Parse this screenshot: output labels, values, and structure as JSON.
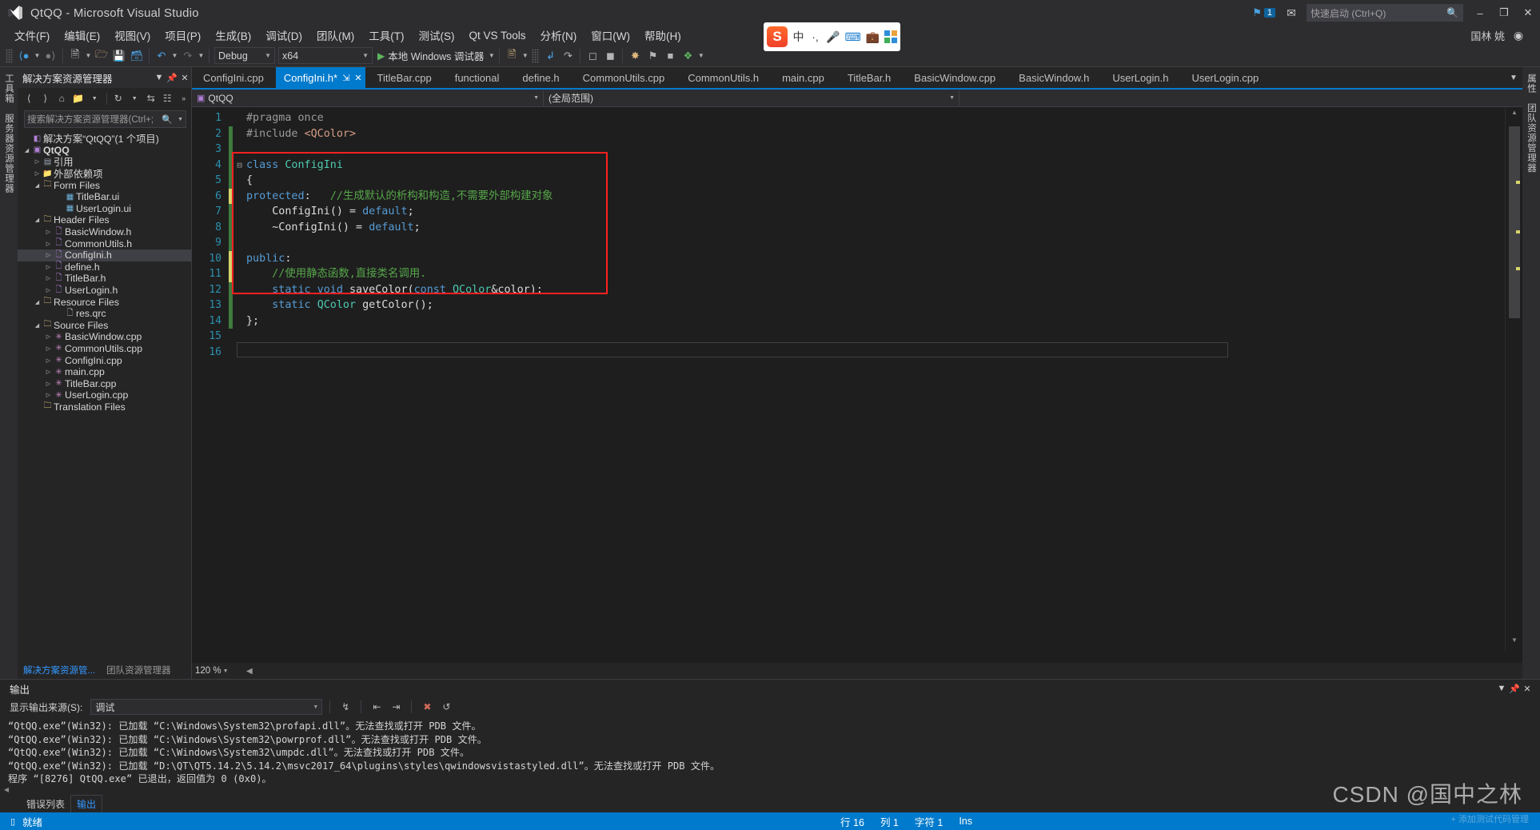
{
  "window": {
    "title": "QtQQ - Microsoft Visual Studio",
    "minimize": "–",
    "maximize": "❐",
    "close": "✕",
    "user_name": "国林 姚",
    "lang_flag": "中",
    "notify_count": "1"
  },
  "quick_launch": {
    "placeholder": "快速启动 (Ctrl+Q)"
  },
  "menu": {
    "items": [
      "文件(F)",
      "编辑(E)",
      "视图(V)",
      "项目(P)",
      "生成(B)",
      "调试(D)",
      "团队(M)",
      "工具(T)",
      "测试(S)",
      "Qt VS Tools",
      "分析(N)",
      "窗口(W)",
      "帮助(H)"
    ]
  },
  "toolbar": {
    "config": "Debug",
    "platform": "x64",
    "run_label": "本地 Windows 调试器",
    "icons": [
      "back-nav",
      "forward-nav",
      "new-project",
      "open-file",
      "save",
      "save-all",
      "undo",
      "redo"
    ]
  },
  "center_cluster": {
    "brand": "S",
    "lang": "中",
    "items": [
      "dots",
      "mic",
      "keyboard",
      "toolbox",
      "grid"
    ]
  },
  "solution_explorer": {
    "title": "解决方案资源管理器",
    "search_placeholder": "搜索解决方案资源管理器(Ctrl+;",
    "tabs": [
      {
        "label": "解决方案资源管...",
        "active": true
      },
      {
        "label": "团队资源管理器",
        "active": false
      }
    ],
    "tree": [
      {
        "label": "解决方案“QtQQ”(1 个项目)",
        "indent": 1,
        "twisty": "",
        "icon": "solution-icon",
        "bold": false,
        "selected": false
      },
      {
        "label": "QtQQ",
        "indent": 1,
        "twisty": "◢",
        "icon": "project-icon",
        "bold": true,
        "selected": false
      },
      {
        "label": "引用",
        "indent": 2,
        "twisty": "▷",
        "icon": "references-icon",
        "bold": false,
        "selected": false
      },
      {
        "label": "外部依赖项",
        "indent": 2,
        "twisty": "▷",
        "icon": "folder-icon",
        "bold": false,
        "selected": false
      },
      {
        "label": "Form Files",
        "indent": 2,
        "twisty": "◢",
        "icon": "filter-folder-icon",
        "bold": false,
        "selected": false
      },
      {
        "label": "TitleBar.ui",
        "indent": 4,
        "twisty": "",
        "icon": "ui-file-icon",
        "bold": false,
        "selected": false
      },
      {
        "label": "UserLogin.ui",
        "indent": 4,
        "twisty": "",
        "icon": "ui-file-icon",
        "bold": false,
        "selected": false
      },
      {
        "label": "Header Files",
        "indent": 2,
        "twisty": "◢",
        "icon": "filter-folder-icon",
        "bold": false,
        "selected": false
      },
      {
        "label": "BasicWindow.h",
        "indent": 3,
        "twisty": "▷",
        "icon": "header-file-icon",
        "bold": false,
        "selected": false
      },
      {
        "label": "CommonUtils.h",
        "indent": 3,
        "twisty": "▷",
        "icon": "header-file-icon",
        "bold": false,
        "selected": false
      },
      {
        "label": "ConfigIni.h",
        "indent": 3,
        "twisty": "▷",
        "icon": "header-file-icon",
        "bold": false,
        "selected": true
      },
      {
        "label": "define.h",
        "indent": 3,
        "twisty": "▷",
        "icon": "header-file-icon",
        "bold": false,
        "selected": false
      },
      {
        "label": "TitleBar.h",
        "indent": 3,
        "twisty": "▷",
        "icon": "header-file-icon",
        "bold": false,
        "selected": false
      },
      {
        "label": "UserLogin.h",
        "indent": 3,
        "twisty": "▷",
        "icon": "header-file-icon",
        "bold": false,
        "selected": false
      },
      {
        "label": "Resource Files",
        "indent": 2,
        "twisty": "◢",
        "icon": "filter-folder-icon",
        "bold": false,
        "selected": false
      },
      {
        "label": "res.qrc",
        "indent": 4,
        "twisty": "",
        "icon": "file-icon",
        "bold": false,
        "selected": false
      },
      {
        "label": "Source Files",
        "indent": 2,
        "twisty": "◢",
        "icon": "filter-folder-icon",
        "bold": false,
        "selected": false
      },
      {
        "label": "BasicWindow.cpp",
        "indent": 3,
        "twisty": "▷",
        "icon": "cpp-file-icon",
        "bold": false,
        "selected": false
      },
      {
        "label": "CommonUtils.cpp",
        "indent": 3,
        "twisty": "▷",
        "icon": "cpp-file-icon",
        "bold": false,
        "selected": false
      },
      {
        "label": "ConfigIni.cpp",
        "indent": 3,
        "twisty": "▷",
        "icon": "cpp-file-icon",
        "bold": false,
        "selected": false
      },
      {
        "label": "main.cpp",
        "indent": 3,
        "twisty": "▷",
        "icon": "cpp-file-icon",
        "bold": false,
        "selected": false
      },
      {
        "label": "TitleBar.cpp",
        "indent": 3,
        "twisty": "▷",
        "icon": "cpp-file-icon",
        "bold": false,
        "selected": false
      },
      {
        "label": "UserLogin.cpp",
        "indent": 3,
        "twisty": "▷",
        "icon": "cpp-file-icon",
        "bold": false,
        "selected": false
      },
      {
        "label": "Translation Files",
        "indent": 2,
        "twisty": "",
        "icon": "filter-folder-icon",
        "bold": false,
        "selected": false
      }
    ]
  },
  "editor": {
    "tabs": [
      {
        "label": "ConfigIni.cpp",
        "active": false
      },
      {
        "label": "ConfigIni.h*",
        "active": true
      },
      {
        "label": "TitleBar.cpp",
        "active": false
      },
      {
        "label": "functional",
        "active": false
      },
      {
        "label": "define.h",
        "active": false
      },
      {
        "label": "CommonUtils.cpp",
        "active": false
      },
      {
        "label": "CommonUtils.h",
        "active": false
      },
      {
        "label": "main.cpp",
        "active": false
      },
      {
        "label": "TitleBar.h",
        "active": false
      },
      {
        "label": "BasicWindow.cpp",
        "active": false
      },
      {
        "label": "BasicWindow.h",
        "active": false
      },
      {
        "label": "UserLogin.h",
        "active": false
      },
      {
        "label": "UserLogin.cpp",
        "active": false
      }
    ],
    "nav_project": "QtQQ",
    "nav_scope": "(全局范围)",
    "zoom": "120 %",
    "lines": [
      {
        "n": "1",
        "change": "none",
        "fold": "",
        "segments": [
          {
            "t": "#pragma once",
            "c": "k-pp"
          }
        ]
      },
      {
        "n": "2",
        "change": "green",
        "fold": "",
        "segments": [
          {
            "t": "#include ",
            "c": "k-pp"
          },
          {
            "t": "<QColor>",
            "c": "k-str"
          }
        ]
      },
      {
        "n": "3",
        "change": "green",
        "fold": "",
        "segments": [
          {
            "t": "",
            "c": "k-plain"
          }
        ]
      },
      {
        "n": "4",
        "change": "green",
        "fold": "⊟",
        "segments": [
          {
            "t": "class ",
            "c": "k-key"
          },
          {
            "t": "ConfigIni",
            "c": "k-type"
          }
        ]
      },
      {
        "n": "5",
        "change": "green",
        "fold": "",
        "segments": [
          {
            "t": "{",
            "c": "k-plain"
          }
        ]
      },
      {
        "n": "6",
        "change": "yellow",
        "fold": "",
        "segments": [
          {
            "t": "protected",
            "c": "k-key"
          },
          {
            "t": ":   ",
            "c": "k-plain"
          },
          {
            "t": "//生成默认的析构和构造,不需要外部构建对象",
            "c": "k-cmt"
          }
        ]
      },
      {
        "n": "7",
        "change": "green",
        "fold": "",
        "segments": [
          {
            "t": "    ConfigIni",
            "c": "k-plain"
          },
          {
            "t": "() = ",
            "c": "k-plain"
          },
          {
            "t": "default",
            "c": "k-key"
          },
          {
            "t": ";",
            "c": "k-plain"
          }
        ]
      },
      {
        "n": "8",
        "change": "green",
        "fold": "",
        "segments": [
          {
            "t": "    ~ConfigIni",
            "c": "k-plain"
          },
          {
            "t": "() = ",
            "c": "k-plain"
          },
          {
            "t": "default",
            "c": "k-key"
          },
          {
            "t": ";",
            "c": "k-plain"
          }
        ]
      },
      {
        "n": "9",
        "change": "green",
        "fold": "",
        "segments": [
          {
            "t": "",
            "c": "k-plain"
          }
        ]
      },
      {
        "n": "10",
        "change": "yellow",
        "fold": "",
        "segments": [
          {
            "t": "public",
            "c": "k-key"
          },
          {
            "t": ":",
            "c": "k-plain"
          }
        ]
      },
      {
        "n": "11",
        "change": "yellow",
        "fold": "",
        "segments": [
          {
            "t": "    //使用静态函数,直接类名调用.",
            "c": "k-cmt"
          }
        ]
      },
      {
        "n": "12",
        "change": "green",
        "fold": "",
        "segments": [
          {
            "t": "    ",
            "c": "k-plain"
          },
          {
            "t": "static void ",
            "c": "k-key"
          },
          {
            "t": "saveColor",
            "c": "k-plain"
          },
          {
            "t": "(",
            "c": "k-plain"
          },
          {
            "t": "const ",
            "c": "k-key"
          },
          {
            "t": "QColor",
            "c": "k-type"
          },
          {
            "t": "&color);",
            "c": "k-plain"
          }
        ]
      },
      {
        "n": "13",
        "change": "green",
        "fold": "",
        "segments": [
          {
            "t": "    ",
            "c": "k-plain"
          },
          {
            "t": "static ",
            "c": "k-key"
          },
          {
            "t": "QColor",
            "c": "k-type"
          },
          {
            "t": " getColor();",
            "c": "k-plain"
          }
        ]
      },
      {
        "n": "14",
        "change": "green",
        "fold": "",
        "segments": [
          {
            "t": "};",
            "c": "k-plain"
          }
        ]
      },
      {
        "n": "15",
        "change": "none",
        "fold": "",
        "segments": [
          {
            "t": "",
            "c": "k-plain"
          }
        ]
      },
      {
        "n": "16",
        "change": "none",
        "fold": "",
        "segments": [
          {
            "t": "",
            "c": "k-plain"
          }
        ]
      }
    ]
  },
  "output_panel": {
    "title": "输出",
    "source_label": "显示输出来源(S):",
    "source_value": "调试",
    "lines": [
      "“QtQQ.exe”(Win32): 已加载 “C:\\Windows\\System32\\profapi.dll”。无法查找或打开 PDB 文件。",
      "“QtQQ.exe”(Win32): 已加载 “C:\\Windows\\System32\\powrprof.dll”。无法查找或打开 PDB 文件。",
      "“QtQQ.exe”(Win32): 已加载 “C:\\Windows\\System32\\umpdc.dll”。无法查找或打开 PDB 文件。",
      "“QtQQ.exe”(Win32): 已加载 “D:\\QT\\QT5.14.2\\5.14.2\\msvc2017_64\\plugins\\styles\\qwindowsvistastyled.dll”。无法查找或打开 PDB 文件。",
      "程序 “[8276] QtQQ.exe” 已退出，返回值为 0 (0x0)。"
    ]
  },
  "bottom_tabs": [
    {
      "label": "错误列表",
      "active": false
    },
    {
      "label": "输出",
      "active": true
    }
  ],
  "statusbar": {
    "status": "就绪",
    "line": "行 16",
    "col": "列 1",
    "char": "字符 1",
    "ins": "Ins"
  },
  "watermark": {
    "text": "CSDN @国中之林",
    "sub": "+ 添加测试代码管理"
  },
  "left_rail": {
    "labels": [
      "工具箱",
      "服务器资源管理器"
    ]
  },
  "right_rail": {
    "labels": [
      "属性",
      "团队资源管理器"
    ]
  },
  "colors": {
    "accent": "#007acc",
    "bg": "#1e1e1e",
    "chrome": "#2d2d30",
    "panel": "#252526",
    "highlight_box": "#ff2020"
  }
}
